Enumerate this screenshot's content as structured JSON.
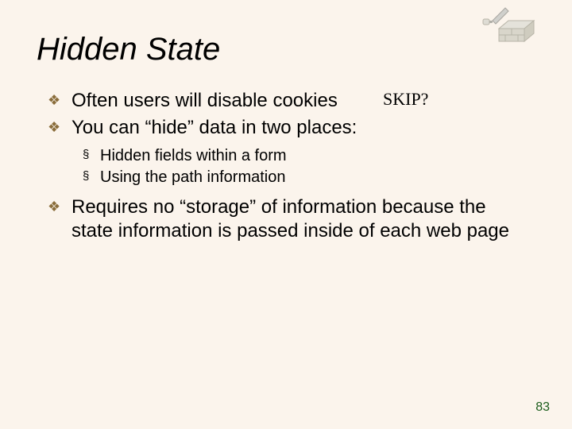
{
  "title": "Hidden State",
  "annotation": "SKIP?",
  "bullets": {
    "b1": "Often users will disable cookies",
    "b2": "You can “hide” data in two places:",
    "b2_sub1": "Hidden fields within a form",
    "b2_sub2": "Using the path information",
    "b3": "Requires no “storage” of information because the state information is passed inside of each web page"
  },
  "glyphs": {
    "diamond": "❖",
    "square": "§"
  },
  "page_number": "83"
}
